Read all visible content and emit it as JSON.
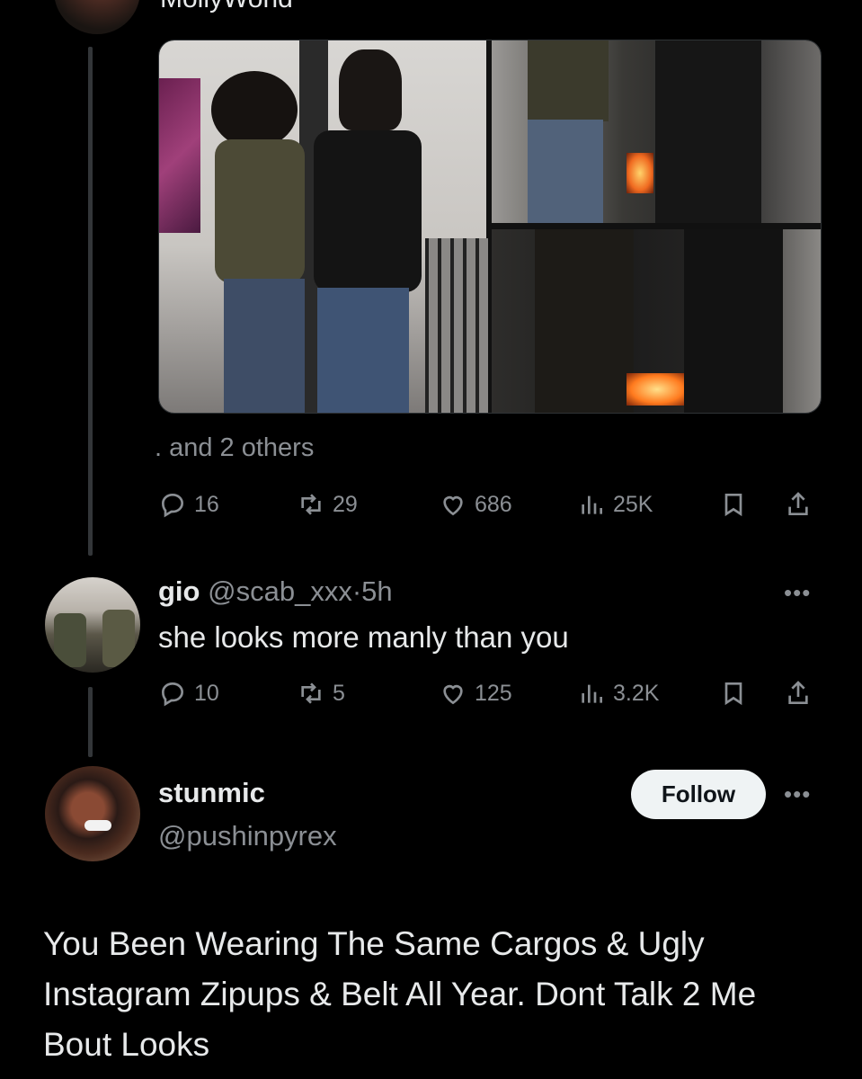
{
  "top_post": {
    "header_name_partial": "MollyWorld",
    "others_text": ". and 2 others",
    "stats": {
      "replies": "16",
      "reposts": "29",
      "likes": "686",
      "views": "25K"
    }
  },
  "reply": {
    "name": "gio",
    "handle": "@scab_xxx",
    "separator": "·",
    "time": "5h",
    "text": "she looks more manly than you",
    "stats": {
      "replies": "10",
      "reposts": "5",
      "likes": "125",
      "views": "3.2K"
    }
  },
  "main_post": {
    "name": "stunmic",
    "handle": "@pushinpyrex",
    "follow_label": "Follow",
    "text": "You Been Wearing The Same Cargos & Ugly Instagram Zipups & Belt All Year. Dont Talk 2 Me Bout Looks"
  },
  "icons": [
    "reply-icon",
    "repost-icon",
    "like-icon",
    "views-icon",
    "bookmark-icon",
    "share-icon",
    "more-icon"
  ],
  "colors": {
    "background": "#000000",
    "text": "#e7e9ea",
    "muted": "#8b8f94",
    "follow_bg": "#eff3f4"
  }
}
